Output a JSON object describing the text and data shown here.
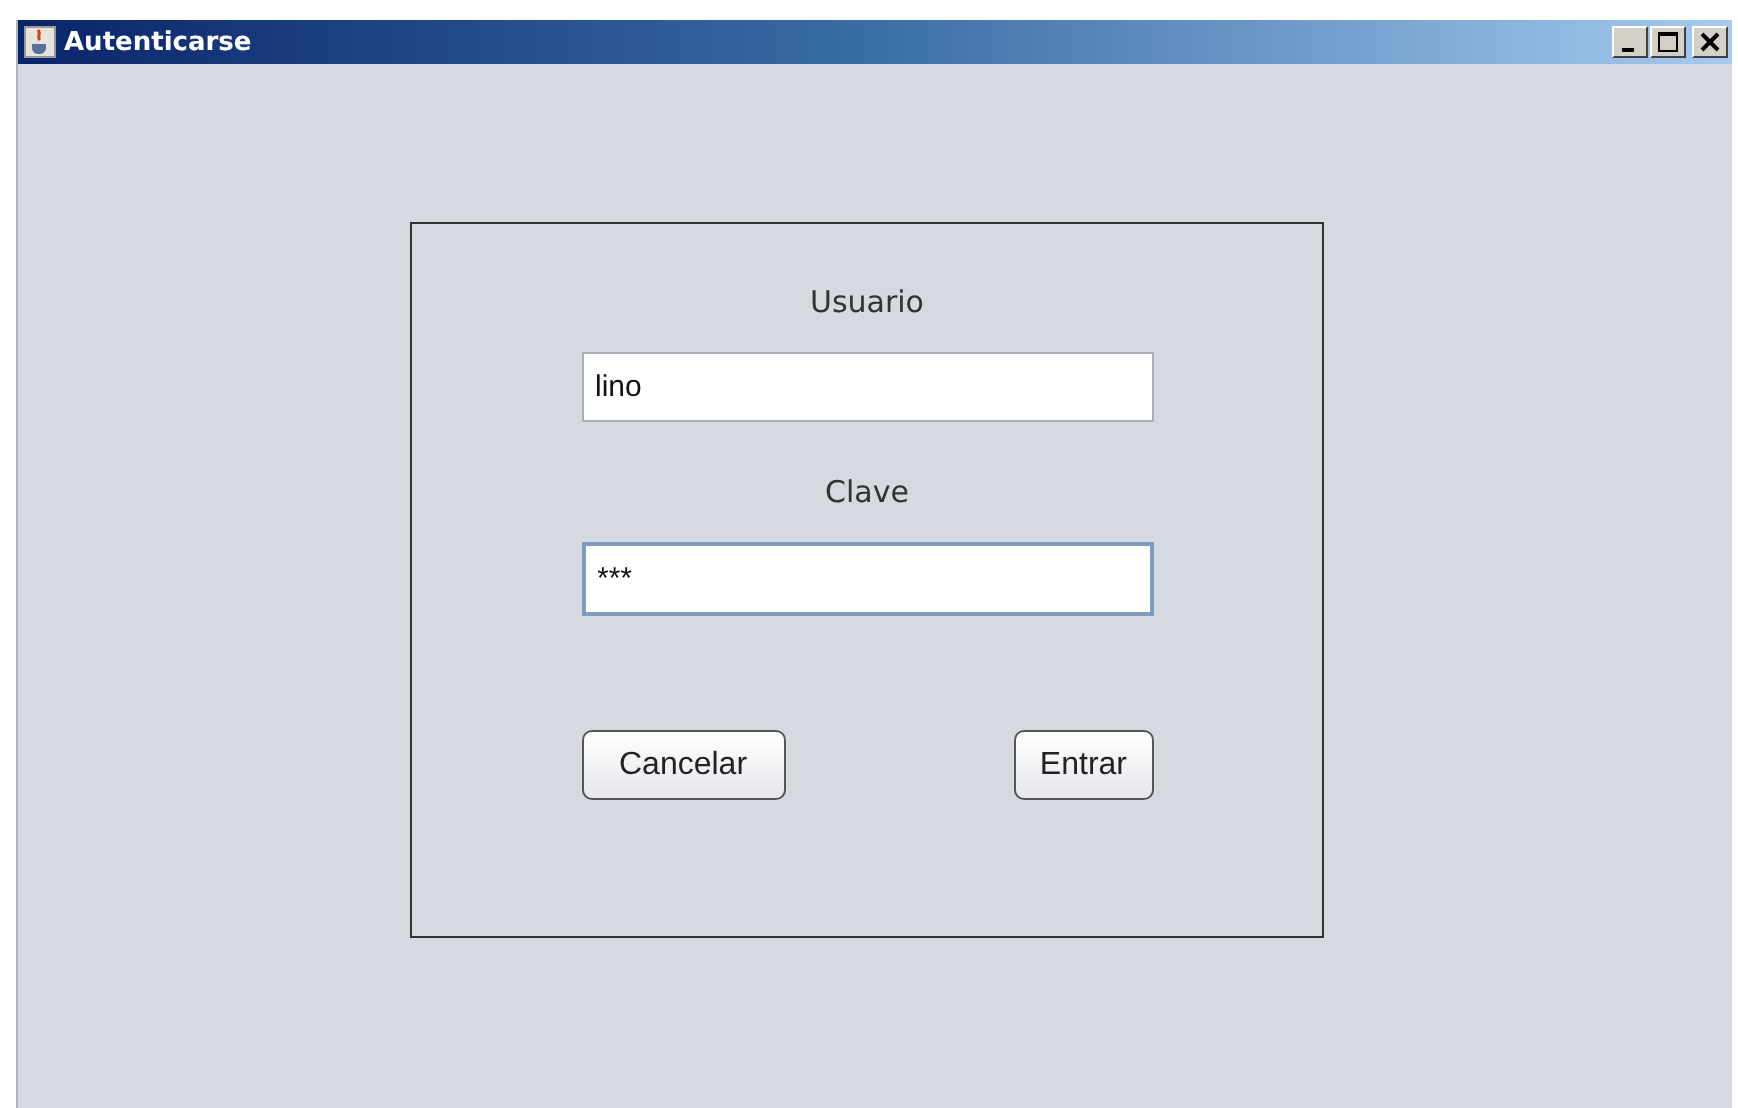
{
  "window": {
    "title": "Autenticarse"
  },
  "form": {
    "user_label": "Usuario",
    "user_field": {
      "value": "lino",
      "focused": false
    },
    "password_label": "Clave",
    "password_field": {
      "value": "***",
      "focused": true
    },
    "buttons": [
      {
        "label": "Cancelar"
      },
      {
        "label": "Entrar"
      }
    ]
  }
}
